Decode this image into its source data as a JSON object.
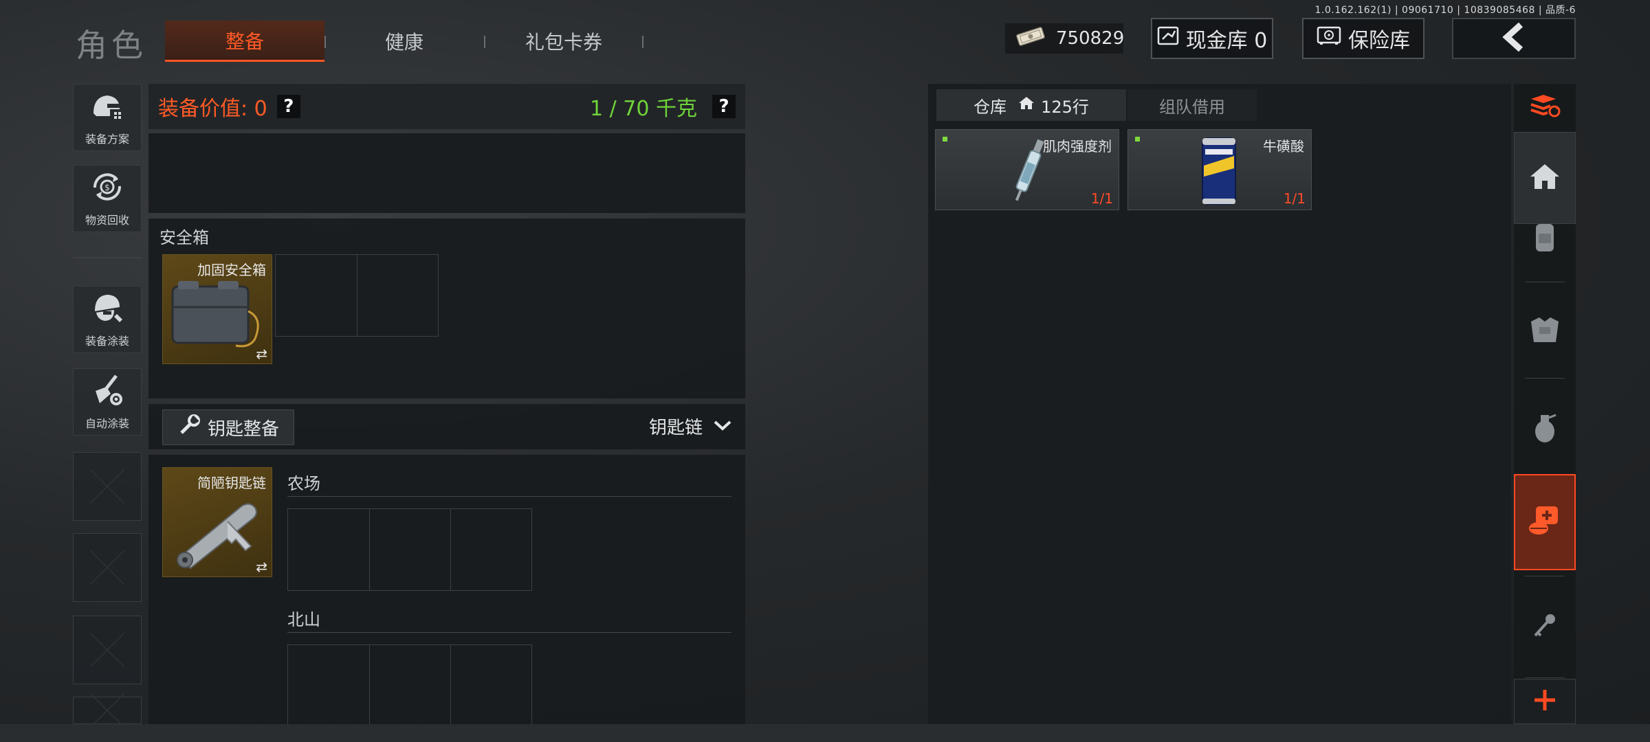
{
  "version_text": "1.0.162.162(1) | 09061710 | 10839085468 | 品质-6",
  "header": {
    "title": "角色",
    "tabs": [
      {
        "label": "整备",
        "active": true
      },
      {
        "label": "健康",
        "active": false
      },
      {
        "label": "礼包卡券",
        "active": false
      }
    ],
    "money": "750829",
    "cash_vault": "现金库 0",
    "safe_vault": "保险库"
  },
  "sidebar": {
    "items": [
      {
        "label": "装备方案",
        "icon": "helmet-plan-icon"
      },
      {
        "label": "物资回收",
        "icon": "recycle-icon"
      },
      {
        "label": "装备涂装",
        "icon": "helmet-paint-icon"
      },
      {
        "label": "自动涂装",
        "icon": "broom-gear-icon"
      }
    ]
  },
  "equipment": {
    "value_label": "装备价值: 0",
    "weight_label": "1 / 70 千克",
    "help_symbol": "?",
    "safe_box_title": "安全箱",
    "safe_box_item": "加固安全箱",
    "swap_symbol": "⇄",
    "key_button": "钥匙整备",
    "key_dropdown": "钥匙链",
    "keychain_item": "简陋钥匙链",
    "key_zones": [
      "农场",
      "北山"
    ]
  },
  "warehouse": {
    "tab_storage": "仓库",
    "rows_label": "125行",
    "tab_team": "组队借用",
    "items": [
      {
        "name": "肌肉强度剂",
        "count": "1/1"
      },
      {
        "name": "牛磺酸",
        "count": "1/1"
      }
    ]
  },
  "right_column": {
    "icons": [
      "layers-refresh-icon",
      "home-icon",
      "backpack-icon",
      "armor-vest-icon",
      "grenade-icon",
      "medkit-icon",
      "key-icon",
      "plus-icon"
    ],
    "active_index": 5
  },
  "colors": {
    "accent": "#ff5522",
    "weight_green": "#6fd43a",
    "gold_item": "#5e4818",
    "count_red": "#ff4a2a"
  }
}
